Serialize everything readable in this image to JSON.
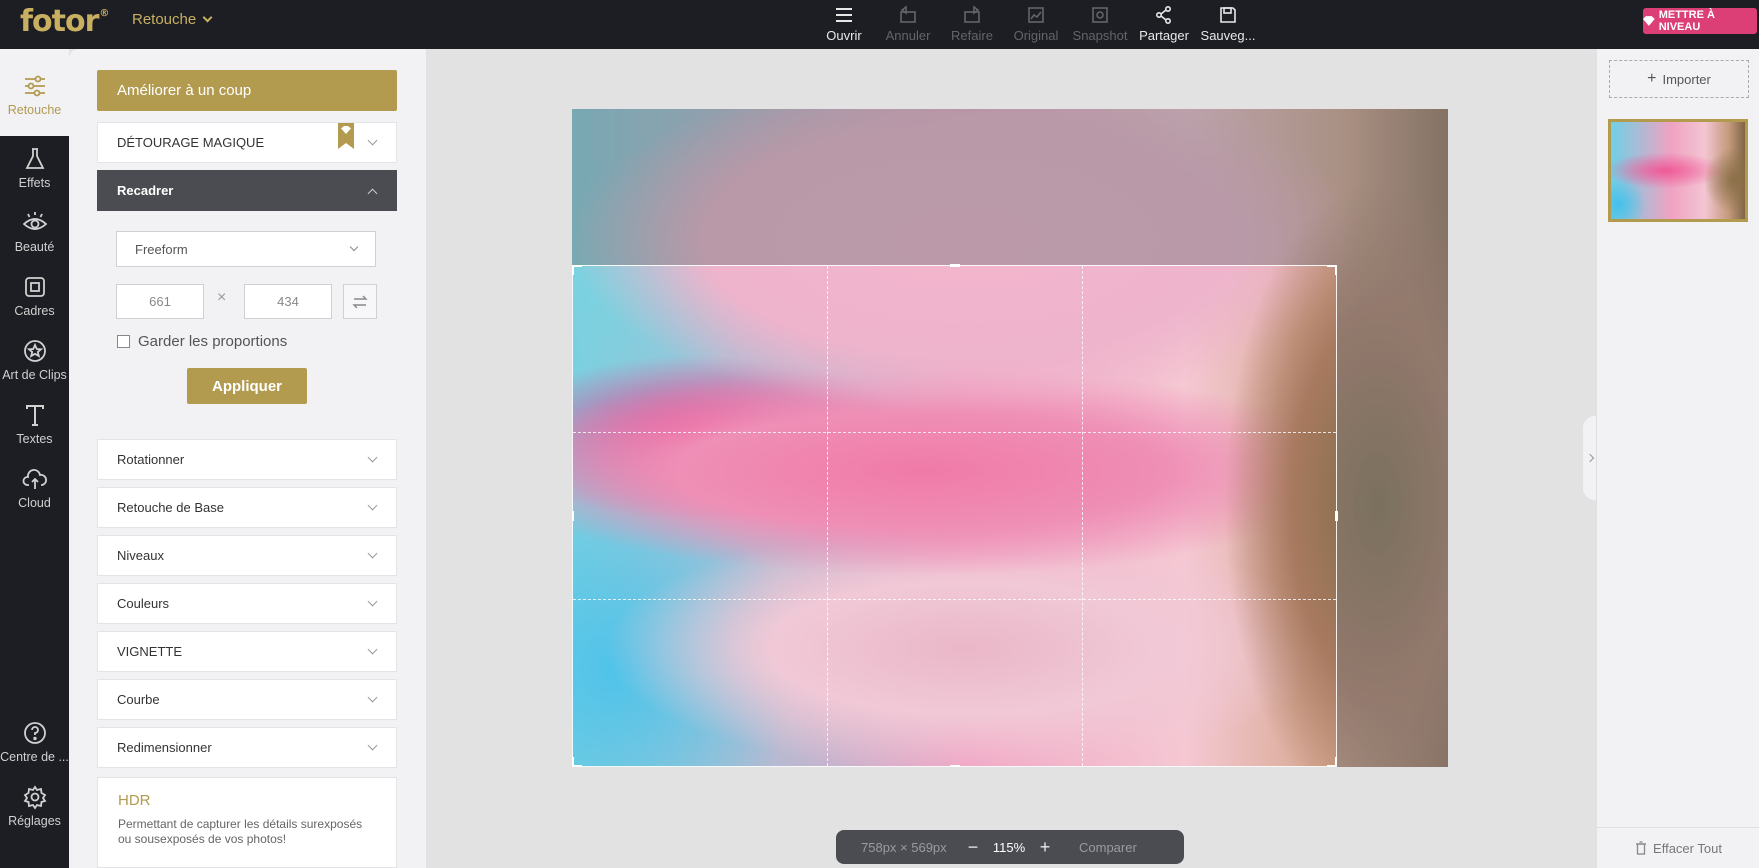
{
  "app": {
    "logo": "fotor",
    "logo_mark": "®",
    "module": "Retouche"
  },
  "toolbar": {
    "open": "Ouvrir",
    "undo": "Annuler",
    "redo": "Refaire",
    "original": "Original",
    "snapshot": "Snapshot",
    "share": "Partager",
    "save": "Sauveg..."
  },
  "upgrade": {
    "label": "METTRE À NIVEAU",
    "color": "#dc3f76"
  },
  "nav": {
    "retouche": "Retouche",
    "effets": "Effets",
    "beaute": "Beauté",
    "cadres": "Cadres",
    "clipart": "Art de Clips",
    "textes": "Textes",
    "cloud": "Cloud",
    "help": "Centre de ...",
    "settings": "Réglages"
  },
  "panel": {
    "auto_enhance": "Améliorer à un coup",
    "magic_cutout": "DÉTOURAGE MAGIQUE",
    "crop": {
      "title": "Recadrer",
      "ratio": "Freeform",
      "width": "661",
      "height": "434",
      "times": "×",
      "keep_ratio": "Garder les proportions",
      "apply": "Appliquer"
    },
    "sections": {
      "rotate": "Rotationner",
      "basic": "Retouche de Base",
      "levels": "Niveaux",
      "colors": "Couleurs",
      "vignette": "VIGNETTE",
      "curve": "Courbe",
      "resize": "Redimensionner"
    },
    "hdr": {
      "title": "HDR",
      "description": "Permettant de capturer les détails surexposés ou sousexposés de vos photos!"
    }
  },
  "canvas": {
    "image_size": "758px × 569px",
    "zoom": "115%",
    "zoom_out": "−",
    "zoom_in": "+",
    "compare": "Comparer"
  },
  "right": {
    "import": "Importer",
    "clear_all": "Effacer Tout"
  },
  "colors": {
    "accent": "#b29a4e",
    "dark": "#1d1e24",
    "panel": "#f2f2f4"
  }
}
